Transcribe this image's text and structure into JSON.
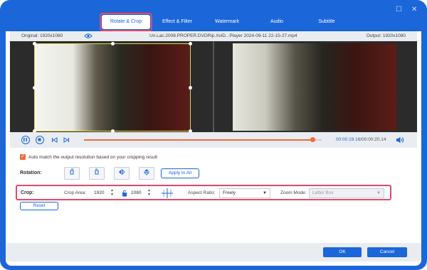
{
  "tabs": [
    {
      "label": "Rotate & Crop",
      "active": true
    },
    {
      "label": "Effect & Filter"
    },
    {
      "label": "Watermark"
    },
    {
      "label": "Audio"
    },
    {
      "label": "Subtitle"
    }
  ],
  "infobar": {
    "original": "Original: 1920x1080",
    "file": "Un.Lac.2008.PROPER.DVDRip.XviD...Player 2024-09-11 22-15-27.mp4",
    "output": "Output: 1920x1080"
  },
  "playback": {
    "current_time": "00:00:19.16",
    "separator": "/",
    "duration": "00:00:20.14",
    "progress": 0.96
  },
  "auto_match": {
    "checked": true,
    "label": "Auto match the output resolution based on your cropping result"
  },
  "rotation": {
    "label": "Rotation:",
    "apply_all": "Apply to All"
  },
  "crop": {
    "label": "Crop:",
    "area_label": "Crop Area:",
    "width": "1920",
    "height": "1080",
    "aspect_label": "Aspect Ratio:",
    "aspect_value": "Freely",
    "zoom_label": "Zoom Mode:",
    "zoom_value": "Letter Box"
  },
  "reset_label": "Reset",
  "footer": {
    "ok": "OK",
    "cancel": "Cancel"
  },
  "colors": {
    "accent": "#1b66d8",
    "highlight": "#e5486a",
    "progress": "#f06a3a"
  }
}
